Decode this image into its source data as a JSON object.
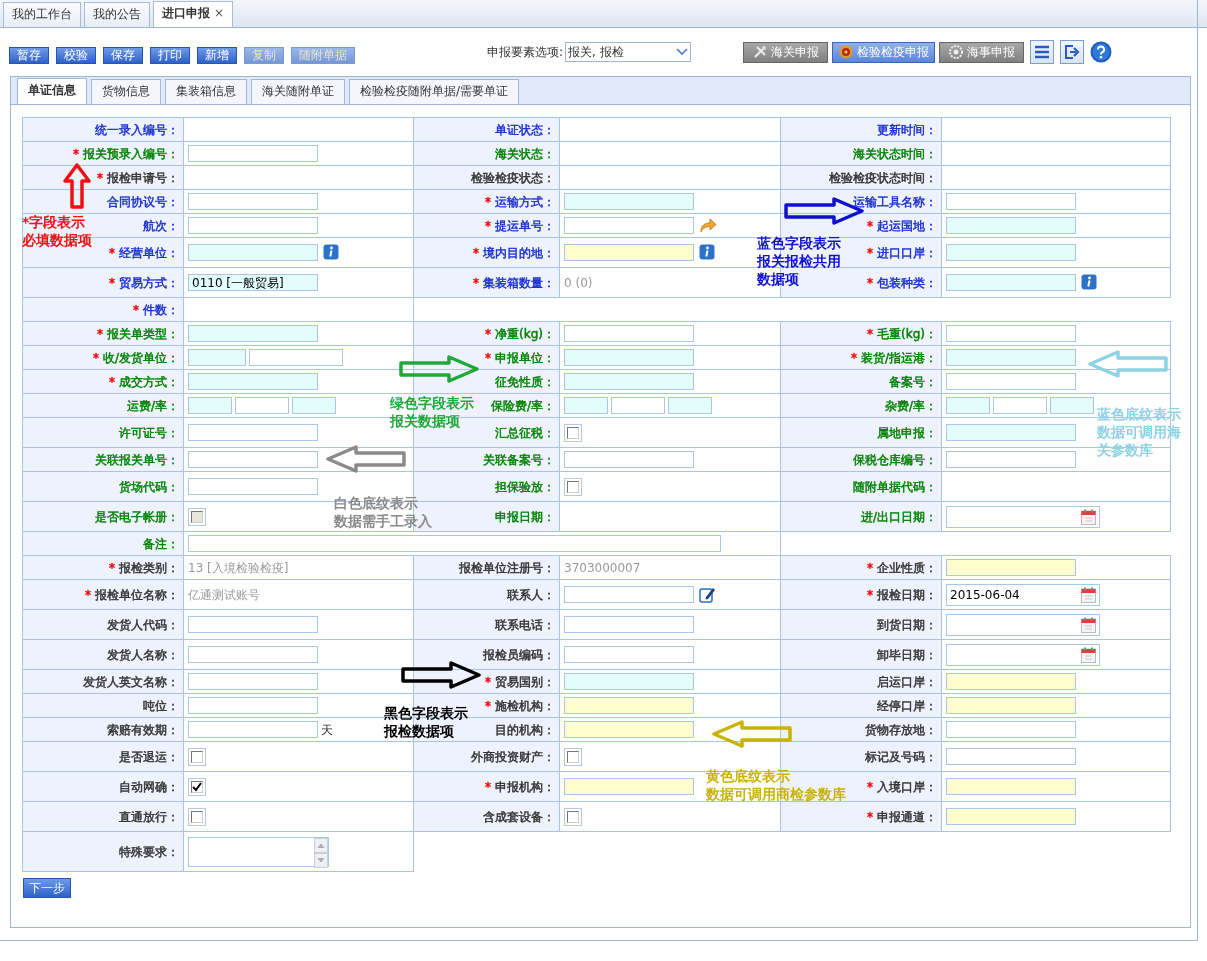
{
  "top_tabs": [
    {
      "label": "我的工作台",
      "selected": false
    },
    {
      "label": "我的公告",
      "selected": false
    },
    {
      "label": "进口申报",
      "selected": true,
      "close": "×"
    }
  ],
  "toolbar": {
    "buttons": [
      {
        "label": "暂存",
        "disabled": false
      },
      {
        "label": "校验",
        "disabled": false
      },
      {
        "label": "保存",
        "disabled": false
      },
      {
        "label": "打印",
        "disabled": false
      },
      {
        "label": "新增",
        "disabled": false
      },
      {
        "label": "复制",
        "disabled": true
      },
      {
        "label": "随附单据",
        "disabled": true
      }
    ],
    "option_label": "申报要素选项:",
    "option_value": "报关, 报检",
    "declare_buttons": [
      {
        "label": "海关申报",
        "highlighted": false
      },
      {
        "label": "检验检疫申报",
        "highlighted": true
      },
      {
        "label": "海事申报",
        "highlighted": false
      }
    ]
  },
  "form_tabs": [
    {
      "label": "单证信息",
      "selected": true
    },
    {
      "label": "货物信息",
      "selected": false
    },
    {
      "label": "集装箱信息",
      "selected": false
    },
    {
      "label": "海关随附单证",
      "selected": false
    },
    {
      "label": "检验检疫随附单据/需要单证",
      "selected": false
    }
  ],
  "rows": [
    {
      "cells": [
        {
          "label": "统一录入编号：",
          "color": "#1a2fd0"
        },
        {
          "label": "单证状态：",
          "color": "#1a2fd0"
        },
        {
          "label": "更新时间：",
          "color": "#1a2fd0"
        }
      ]
    },
    {
      "cells": [
        {
          "label": "报关预录入编号：",
          "required_mark": "*",
          "color": "#008000",
          "field": {
            "kind": "input",
            "inputs": [
              {
                "color": "#ffffff"
              }
            ]
          }
        },
        {
          "label": "海关状态：",
          "color": "#008000"
        },
        {
          "label": "海关状态时间：",
          "color": "#008000"
        }
      ]
    },
    {
      "cells": [
        {
          "label": "报检申请号：",
          "required_mark": "*",
          "color": "#333333"
        },
        {
          "label": "检验检疫状态：",
          "color": "#333333"
        },
        {
          "label": "检验检疫状态时间：",
          "color": "#333333"
        }
      ]
    },
    {
      "cells": [
        {
          "label": "合同协议号：",
          "color": "#1a2fd0",
          "field": {
            "kind": "input",
            "inputs": [
              {
                "color": "#ffffff"
              }
            ]
          }
        },
        {
          "label": "运输方式：",
          "required_mark": "*",
          "color": "#1a2fd0",
          "field": {
            "kind": "input",
            "inputs": [
              {
                "color": "#e3fdfb"
              }
            ]
          }
        },
        {
          "label": "运输工具名称：",
          "color": "#1a2fd0",
          "field": {
            "kind": "input",
            "inputs": [
              {
                "color": "#ffffff"
              }
            ]
          }
        }
      ]
    },
    {
      "cells": [
        {
          "label": "航次：",
          "color": "#1a2fd0",
          "field": {
            "kind": "input",
            "inputs": [
              {
                "color": "#ffffff"
              }
            ]
          }
        },
        {
          "label": "提运单号：",
          "required_mark": "*",
          "color": "#1a2fd0",
          "field": {
            "kind": "input",
            "inputs": [
              {
                "color": "#ffffff"
              }
            ]
          }
        },
        {
          "label": "起运国地：",
          "required_mark": "*",
          "color": "#1a2fd0",
          "field": {
            "kind": "input",
            "inputs": [
              {
                "color": "#e3fdfb"
              }
            ]
          }
        }
      ]
    },
    {
      "cells": [
        {
          "label": "经营单位：",
          "required_mark": "*",
          "color": "#1a2fd0",
          "field": {
            "kind": "input",
            "inputs": [
              {
                "color": "#e3fdfb"
              }
            ]
          }
        },
        {
          "label": "境内目的地：",
          "required_mark": "*",
          "color": "#1a2fd0",
          "field": {
            "kind": "input",
            "inputs": [
              {
                "color": "#ffffcc"
              }
            ]
          }
        },
        {
          "label": "进口口岸：",
          "required_mark": "*",
          "color": "#1a2fd0",
          "field": {
            "kind": "input",
            "inputs": [
              {
                "color": "#e3fdfb"
              }
            ]
          }
        }
      ]
    },
    {
      "cells": [
        {
          "label": "贸易方式：",
          "required_mark": "*",
          "color": "#1a2fd0",
          "field": {
            "kind": "input",
            "inputs": [
              {
                "color": "#e3fdfb",
                "value": "0110 [一般贸易]"
              }
            ]
          }
        },
        {
          "label": "集装箱数量：",
          "required_mark": "*",
          "color": "#1a2fd0",
          "field": {
            "kind": "text",
            "value": "0 (0)"
          }
        },
        {
          "label": "包装种类：",
          "required_mark": "*",
          "color": "#1a2fd0",
          "field": {
            "kind": "input",
            "inputs": [
              {
                "color": "#e3fdfb"
              }
            ]
          }
        }
      ]
    },
    {
      "cells": [
        {
          "label": "件数：",
          "required_mark": "*",
          "color": "#1a2fd0"
        }
      ]
    },
    {
      "cells": [
        {
          "label": "报关单类型：",
          "required_mark": "*",
          "color": "#008000",
          "field": {
            "kind": "input",
            "inputs": [
              {
                "color": "#e3fdfb"
              }
            ]
          }
        },
        {
          "label": "净重(kg)：",
          "required_mark": "*",
          "color": "#008000",
          "field": {
            "kind": "input",
            "inputs": [
              {
                "color": "#ffffff"
              }
            ]
          }
        },
        {
          "label": "毛重(kg)：",
          "required_mark": "*",
          "color": "#008000",
          "field": {
            "kind": "input",
            "inputs": [
              {
                "color": "#ffffff"
              }
            ]
          }
        }
      ]
    },
    {
      "cells": [
        {
          "label": "收/发货单位：",
          "required_mark": "*",
          "color": "#008000",
          "field": {
            "kind": "input",
            "inputs": [
              {
                "color": "#e3fdfb"
              },
              {
                "color": "#ffffff"
              }
            ]
          }
        },
        {
          "label": "申报单位：",
          "required_mark": "*",
          "color": "#008000",
          "field": {
            "kind": "input",
            "inputs": [
              {
                "color": "#e3fdfb"
              }
            ]
          }
        },
        {
          "label": "装货/指运港：",
          "required_mark": "*",
          "color": "#008000",
          "field": {
            "kind": "input",
            "inputs": [
              {
                "color": "#e3fdfb"
              }
            ]
          }
        }
      ]
    },
    {
      "cells": [
        {
          "label": "成交方式：",
          "required_mark": "*",
          "color": "#008000",
          "field": {
            "kind": "input",
            "inputs": [
              {
                "color": "#e3fdfb"
              }
            ]
          }
        },
        {
          "label": "征免性质：",
          "color": "#008000",
          "field": {
            "kind": "input",
            "inputs": [
              {
                "color": "#e3fdfb"
              }
            ]
          }
        },
        {
          "label": "备案号：",
          "color": "#008000",
          "field": {
            "kind": "input",
            "inputs": [
              {
                "color": "#ffffff"
              }
            ]
          }
        }
      ]
    },
    {
      "cells": [
        {
          "label": "运费/率：",
          "color": "#008000",
          "field": {
            "kind": "input",
            "inputs": [
              {
                "color": "#e3fdfb"
              },
              {
                "color": "#ffffff"
              },
              {
                "color": "#e3fdfb"
              }
            ]
          }
        },
        {
          "label": "保险费/率：",
          "color": "#008000",
          "field": {
            "kind": "input",
            "inputs": [
              {
                "color": "#e3fdfb"
              },
              {
                "color": "#ffffff"
              },
              {
                "color": "#e3fdfb"
              }
            ]
          }
        },
        {
          "label": "杂费/率：",
          "color": "#008000",
          "field": {
            "kind": "input",
            "inputs": [
              {
                "color": "#e3fdfb"
              },
              {
                "color": "#ffffff"
              },
              {
                "color": "#e3fdfb"
              }
            ]
          }
        }
      ]
    },
    {
      "cells": [
        {
          "label": "许可证号：",
          "color": "#008000",
          "field": {
            "kind": "input",
            "inputs": [
              {
                "color": "#ffffff"
              }
            ]
          }
        },
        {
          "label": "汇总征税：",
          "color": "#008000",
          "field": {
            "kind": "checkbox",
            "checked": false,
            "disabled": false
          }
        },
        {
          "label": "属地申报：",
          "color": "#008000",
          "field": {
            "kind": "input",
            "inputs": [
              {
                "color": "#e3fdfb"
              }
            ]
          }
        }
      ]
    },
    {
      "cells": [
        {
          "label": "关联报关单号：",
          "color": "#008000",
          "field": {
            "kind": "input",
            "inputs": [
              {
                "color": "#ffffff"
              }
            ]
          }
        },
        {
          "label": "关联备案号：",
          "color": "#008000",
          "field": {
            "kind": "input",
            "inputs": [
              {
                "color": "#ffffff"
              }
            ]
          }
        },
        {
          "label": "保税仓库编号：",
          "color": "#008000",
          "field": {
            "kind": "input",
            "inputs": [
              {
                "color": "#ffffff"
              }
            ]
          }
        }
      ]
    },
    {
      "cells": [
        {
          "label": "货场代码：",
          "color": "#008000",
          "field": {
            "kind": "input",
            "inputs": [
              {
                "color": "#ffffff"
              }
            ]
          }
        },
        {
          "label": "担保验放：",
          "color": "#008000",
          "field": {
            "kind": "checkbox",
            "checked": false,
            "disabled": false
          }
        },
        {
          "label": "随附单据代码：",
          "color": "#008000"
        }
      ]
    },
    {
      "cells": [
        {
          "label": "是否电子帐册：",
          "color": "#008000",
          "field": {
            "kind": "checkbox",
            "checked": false,
            "disabled": true
          }
        },
        {
          "label": "申报日期：",
          "color": "#008000"
        },
        {
          "label": "进/出口日期：",
          "color": "#008000",
          "field": {
            "kind": "date"
          }
        }
      ]
    },
    {
      "cells": [
        {
          "label": "备注：",
          "color": "#008000",
          "field": {
            "kind": "wide",
            "inputs": [
              {
                "color": "#ffffff"
              }
            ]
          }
        }
      ]
    },
    {
      "cells": [
        {
          "label": "报检类别：",
          "required_mark": "*",
          "color": "#333333",
          "field": {
            "kind": "text",
            "value": "13 [入境检验检疫]"
          }
        },
        {
          "label": "报检单位注册号：",
          "color": "#333333",
          "field": {
            "kind": "text",
            "value": "3703000007"
          }
        },
        {
          "label": "企业性质：",
          "required_mark": "*",
          "color": "#333333",
          "field": {
            "kind": "input",
            "inputs": [
              {
                "color": "#ffffcc"
              }
            ]
          }
        }
      ]
    },
    {
      "cells": [
        {
          "label": "报检单位名称：",
          "required_mark": "*",
          "color": "#333333",
          "field": {
            "kind": "text",
            "value": "亿通测试账号"
          }
        },
        {
          "label": "联系人：",
          "color": "#333333",
          "field": {
            "kind": "input",
            "inputs": [
              {
                "color": "#ffffff"
              }
            ]
          }
        },
        {
          "label": "报检日期：",
          "required_mark": "*",
          "color": "#333333",
          "field": {
            "kind": "date",
            "value": "2015-06-04"
          }
        }
      ]
    },
    {
      "cells": [
        {
          "label": "发货人代码：",
          "color": "#333333",
          "field": {
            "kind": "input",
            "inputs": [
              {
                "color": "#ffffff"
              }
            ]
          }
        },
        {
          "label": "联系电话：",
          "color": "#333333",
          "field": {
            "kind": "input",
            "inputs": [
              {
                "color": "#ffffff"
              }
            ]
          }
        },
        {
          "label": "到货日期：",
          "color": "#333333",
          "field": {
            "kind": "date"
          }
        }
      ]
    },
    {
      "cells": [
        {
          "label": "发货人名称：",
          "color": "#333333",
          "field": {
            "kind": "input",
            "inputs": [
              {
                "color": "#ffffff"
              }
            ]
          }
        },
        {
          "label": "报检员编码：",
          "color": "#333333",
          "field": {
            "kind": "input",
            "inputs": [
              {
                "color": "#ffffff"
              }
            ]
          }
        },
        {
          "label": "卸毕日期：",
          "color": "#333333",
          "field": {
            "kind": "date"
          }
        }
      ]
    },
    {
      "cells": [
        {
          "label": "发货人英文名称：",
          "color": "#333333",
          "field": {
            "kind": "input",
            "inputs": [
              {
                "color": "#ffffff"
              }
            ]
          }
        },
        {
          "label": "贸易国别：",
          "required_mark": "*",
          "color": "#333333",
          "field": {
            "kind": "input",
            "inputs": [
              {
                "color": "#e3fdfb"
              }
            ]
          }
        },
        {
          "label": "启运口岸：",
          "color": "#333333",
          "field": {
            "kind": "input",
            "inputs": [
              {
                "color": "#ffffcc"
              }
            ]
          }
        }
      ]
    },
    {
      "cells": [
        {
          "label": "吨位：",
          "color": "#333333",
          "field": {
            "kind": "input",
            "inputs": [
              {
                "color": "#ffffff"
              }
            ]
          }
        },
        {
          "label": "施检机构：",
          "required_mark": "*",
          "color": "#333333",
          "field": {
            "kind": "input",
            "inputs": [
              {
                "color": "#ffffcc"
              }
            ]
          }
        },
        {
          "label": "经停口岸：",
          "color": "#333333",
          "field": {
            "kind": "input",
            "inputs": [
              {
                "color": "#ffffcc"
              }
            ]
          }
        }
      ]
    },
    {
      "cells": [
        {
          "label": "索赔有效期：",
          "color": "#333333",
          "field": {
            "kind": "input",
            "inputs": [
              {
                "color": "#ffffff"
              }
            ],
            "suffix": "天"
          }
        },
        {
          "label": "目的机构：",
          "color": "#333333",
          "field": {
            "kind": "input",
            "inputs": [
              {
                "color": "#ffffcc"
              }
            ]
          }
        },
        {
          "label": "货物存放地：",
          "color": "#333333",
          "field": {
            "kind": "input",
            "inputs": [
              {
                "color": "#ffffff"
              }
            ]
          }
        }
      ]
    },
    {
      "cells": [
        {
          "label": "是否退运：",
          "color": "#333333",
          "field": {
            "kind": "checkbox",
            "checked": false,
            "disabled": false
          }
        },
        {
          "label": "外商投资财产：",
          "color": "#333333",
          "field": {
            "kind": "checkbox",
            "checked": false,
            "disabled": false
          }
        },
        {
          "label": "标记及号码：",
          "color": "#333333",
          "field": {
            "kind": "input",
            "inputs": [
              {
                "color": "#ffffff"
              }
            ]
          }
        }
      ]
    },
    {
      "cells": [
        {
          "label": "自动网确：",
          "color": "#333333",
          "field": {
            "kind": "checkbox",
            "checked": true,
            "disabled": false
          }
        },
        {
          "label": "申报机构：",
          "required_mark": "*",
          "color": "#333333",
          "field": {
            "kind": "input",
            "inputs": [
              {
                "color": "#ffffcc"
              }
            ]
          }
        },
        {
          "label": "入境口岸：",
          "required_mark": "*",
          "color": "#333333",
          "field": {
            "kind": "input",
            "inputs": [
              {
                "color": "#ffffcc"
              }
            ]
          }
        }
      ]
    },
    {
      "cells": [
        {
          "label": "直通放行：",
          "color": "#333333",
          "field": {
            "kind": "checkbox",
            "checked": false,
            "disabled": false
          }
        },
        {
          "label": "含成套设备：",
          "color": "#333333",
          "field": {
            "kind": "checkbox",
            "checked": false,
            "disabled": false
          }
        },
        {
          "label": "申报通道：",
          "required_mark": "*",
          "color": "#333333",
          "field": {
            "kind": "input",
            "inputs": [
              {
                "color": "#ffffcc"
              }
            ]
          }
        }
      ]
    },
    {
      "cells": [
        {
          "label": "特殊要求：",
          "color": "#333333",
          "field": {
            "kind": "textarea"
          }
        }
      ]
    }
  ],
  "next_button": "下一步",
  "callouts": [
    {
      "lines": [
        "*字段表示",
        "必填数据项"
      ],
      "color": "#ee1111"
    },
    {
      "lines": [
        "蓝色字段表示",
        "报关报检共用",
        "数据项"
      ],
      "color": "#1010d0"
    },
    {
      "lines": [
        "绿色字段表示",
        "报关数据项"
      ],
      "color": "#22a83a"
    },
    {
      "lines": [
        "蓝色底纹表示",
        "数据可调用海",
        "关参数库"
      ],
      "color": "#8fd2e4"
    },
    {
      "lines": [
        "白色底纹表示",
        "数据需手工录入"
      ],
      "color": "#8a8a8a"
    },
    {
      "lines": [
        "黑色字段表示",
        "报检数据项"
      ],
      "color": "#000000"
    },
    {
      "lines": [
        "黄色底纹表示",
        "数据可调用商检参数库"
      ],
      "color": "#c8b400"
    }
  ]
}
